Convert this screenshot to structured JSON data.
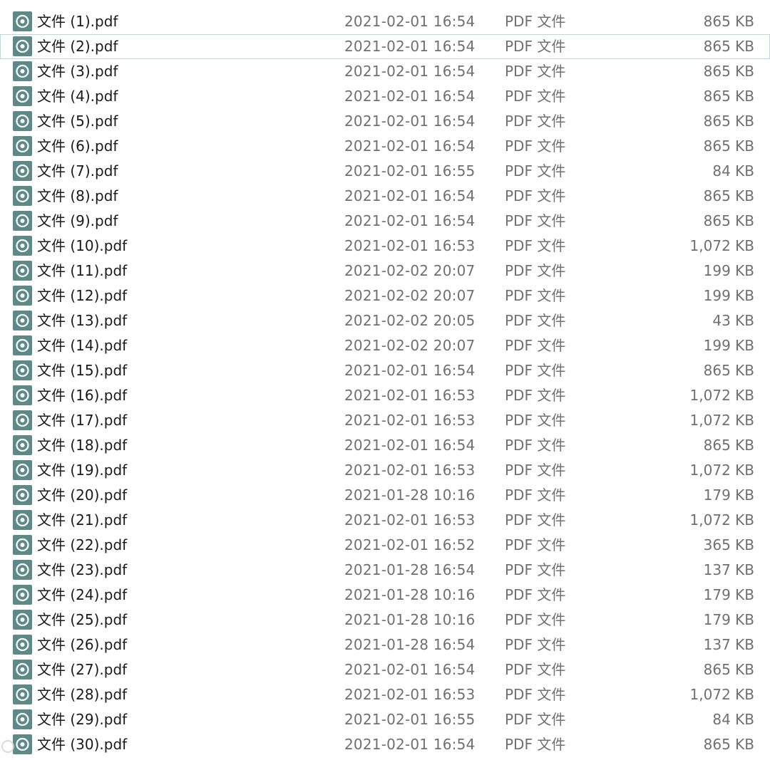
{
  "files": [
    {
      "name": "文件 (1).pdf",
      "date": "2021-02-01 16:54",
      "type": "PDF 文件",
      "size": "865 KB"
    },
    {
      "name": "文件 (2).pdf",
      "date": "2021-02-01 16:54",
      "type": "PDF 文件",
      "size": "865 KB"
    },
    {
      "name": "文件 (3).pdf",
      "date": "2021-02-01 16:54",
      "type": "PDF 文件",
      "size": "865 KB"
    },
    {
      "name": "文件 (4).pdf",
      "date": "2021-02-01 16:54",
      "type": "PDF 文件",
      "size": "865 KB"
    },
    {
      "name": "文件 (5).pdf",
      "date": "2021-02-01 16:54",
      "type": "PDF 文件",
      "size": "865 KB"
    },
    {
      "name": "文件 (6).pdf",
      "date": "2021-02-01 16:54",
      "type": "PDF 文件",
      "size": "865 KB"
    },
    {
      "name": "文件 (7).pdf",
      "date": "2021-02-01 16:55",
      "type": "PDF 文件",
      "size": "84 KB"
    },
    {
      "name": "文件 (8).pdf",
      "date": "2021-02-01 16:54",
      "type": "PDF 文件",
      "size": "865 KB"
    },
    {
      "name": "文件 (9).pdf",
      "date": "2021-02-01 16:54",
      "type": "PDF 文件",
      "size": "865 KB"
    },
    {
      "name": "文件 (10).pdf",
      "date": "2021-02-01 16:53",
      "type": "PDF 文件",
      "size": "1,072 KB"
    },
    {
      "name": "文件 (11).pdf",
      "date": "2021-02-02 20:07",
      "type": "PDF 文件",
      "size": "199 KB"
    },
    {
      "name": "文件 (12).pdf",
      "date": "2021-02-02 20:07",
      "type": "PDF 文件",
      "size": "199 KB"
    },
    {
      "name": "文件 (13).pdf",
      "date": "2021-02-02 20:05",
      "type": "PDF 文件",
      "size": "43 KB"
    },
    {
      "name": "文件 (14).pdf",
      "date": "2021-02-02 20:07",
      "type": "PDF 文件",
      "size": "199 KB"
    },
    {
      "name": "文件 (15).pdf",
      "date": "2021-02-01 16:54",
      "type": "PDF 文件",
      "size": "865 KB"
    },
    {
      "name": "文件 (16).pdf",
      "date": "2021-02-01 16:53",
      "type": "PDF 文件",
      "size": "1,072 KB"
    },
    {
      "name": "文件 (17).pdf",
      "date": "2021-02-01 16:53",
      "type": "PDF 文件",
      "size": "1,072 KB"
    },
    {
      "name": "文件 (18).pdf",
      "date": "2021-02-01 16:54",
      "type": "PDF 文件",
      "size": "865 KB"
    },
    {
      "name": "文件 (19).pdf",
      "date": "2021-02-01 16:53",
      "type": "PDF 文件",
      "size": "1,072 KB"
    },
    {
      "name": "文件 (20).pdf",
      "date": "2021-01-28 10:16",
      "type": "PDF 文件",
      "size": "179 KB"
    },
    {
      "name": "文件 (21).pdf",
      "date": "2021-02-01 16:53",
      "type": "PDF 文件",
      "size": "1,072 KB"
    },
    {
      "name": "文件 (22).pdf",
      "date": "2021-02-01 16:52",
      "type": "PDF 文件",
      "size": "365 KB"
    },
    {
      "name": "文件 (23).pdf",
      "date": "2021-01-28 16:54",
      "type": "PDF 文件",
      "size": "137 KB"
    },
    {
      "name": "文件 (24).pdf",
      "date": "2021-01-28 10:16",
      "type": "PDF 文件",
      "size": "179 KB"
    },
    {
      "name": "文件 (25).pdf",
      "date": "2021-01-28 10:16",
      "type": "PDF 文件",
      "size": "179 KB"
    },
    {
      "name": "文件 (26).pdf",
      "date": "2021-01-28 16:54",
      "type": "PDF 文件",
      "size": "137 KB"
    },
    {
      "name": "文件 (27).pdf",
      "date": "2021-02-01 16:54",
      "type": "PDF 文件",
      "size": "865 KB"
    },
    {
      "name": "文件 (28).pdf",
      "date": "2021-02-01 16:53",
      "type": "PDF 文件",
      "size": "1,072 KB"
    },
    {
      "name": "文件 (29).pdf",
      "date": "2021-02-01 16:55",
      "type": "PDF 文件",
      "size": "84 KB"
    },
    {
      "name": "文件 (30).pdf",
      "date": "2021-02-01 16:54",
      "type": "PDF 文件",
      "size": "865 KB"
    }
  ],
  "icon_name": "pdf-file-icon",
  "colors": {
    "icon_background": "#5d8a88",
    "focus_border": "#b9d7ea",
    "name_text": "#1a1a1a",
    "detail_text": "#707070"
  }
}
